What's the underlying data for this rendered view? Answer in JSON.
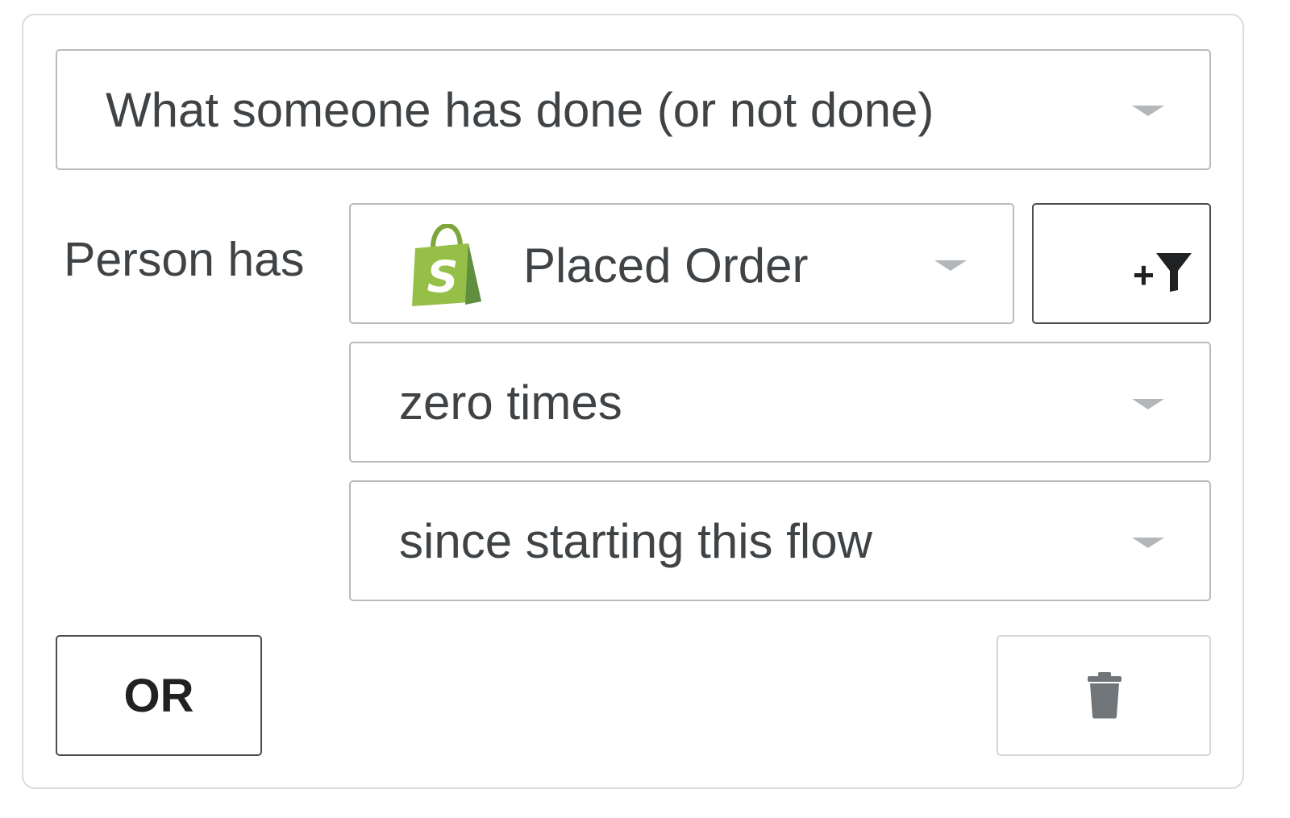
{
  "condition": {
    "type_select": {
      "value": "What someone has done (or not done)"
    },
    "prefix_label": "Person has",
    "metric_select": {
      "value": "Placed Order",
      "icon": "shopify-bag-icon",
      "icon_color": "#95bf47"
    },
    "filter_button": {
      "icon": "add-filter-icon",
      "plus": "+"
    },
    "frequency_select": {
      "value": "zero times"
    },
    "timeframe_select": {
      "value": "since starting this flow"
    }
  },
  "actions": {
    "or_label": "OR",
    "delete_icon": "trash-icon"
  },
  "colors": {
    "text": "#3f4346",
    "border": "#b9bcbf",
    "caret": "#b4b7ba",
    "dark": "#1f2123"
  }
}
